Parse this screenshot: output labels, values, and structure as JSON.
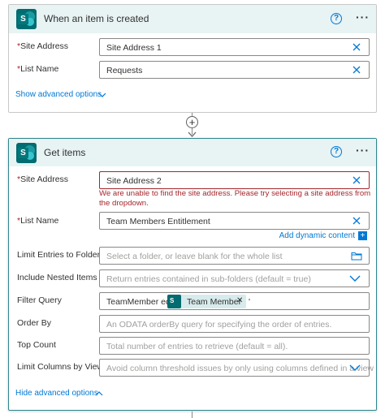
{
  "trigger": {
    "title": "When an item is created",
    "fields": {
      "site_address_label": "Site Address",
      "site_address_value": "Site Address 1",
      "list_name_label": "List Name",
      "list_name_value": "Requests"
    },
    "advanced_link": "Show advanced options",
    "help_glyph": "?",
    "more_glyph": "···"
  },
  "connector": {
    "plus_glyph": "+"
  },
  "action": {
    "title": "Get items",
    "help_glyph": "?",
    "more_glyph": "···",
    "required_mark": "*",
    "site_address_label": "Site Address",
    "site_address_value": "Site Address 2",
    "site_address_error": "We are unable to find the site address. Please try selecting a site address from the dropdown.",
    "list_name_label": "List Name",
    "list_name_value": "Team Members Entitlement",
    "dynamic_content_link": "Add dynamic content",
    "dynamic_plus": "+",
    "limit_folder_label": "Limit Entries to Folder",
    "limit_folder_placeholder": "Select a folder, or leave blank for the whole list",
    "nested_items_label": "Include Nested Items",
    "nested_items_placeholder": "Return entries contained in sub-folders (default = true)",
    "filter_query_label": "Filter Query",
    "filter_query_prefix": "TeamMember eq '",
    "filter_query_token": "Team Member",
    "filter_query_suffix": "'",
    "order_by_label": "Order By",
    "order_by_placeholder": "An ODATA orderBy query for specifying the order of entries.",
    "top_count_label": "Top Count",
    "top_count_placeholder": "Total number of entries to retrieve (default = all).",
    "limit_columns_label": "Limit Columns by View",
    "limit_columns_placeholder": "Avoid column threshold issues by only using columns defined in a view",
    "advanced_link": "Hide advanced options"
  },
  "logo_letter": "S",
  "token_logo_letter": "S",
  "colors": {
    "accent": "#0078d4",
    "header_bg": "#e8f3f4",
    "error": "#a4262c",
    "sharepoint": "#036c70"
  },
  "icons": {
    "logo": "sharepoint-icon",
    "help": "help-icon",
    "more": "more-icon",
    "clear": "close-icon",
    "dropdown": "chevron-down-icon",
    "folder": "folder-icon",
    "add": "plus-icon"
  }
}
